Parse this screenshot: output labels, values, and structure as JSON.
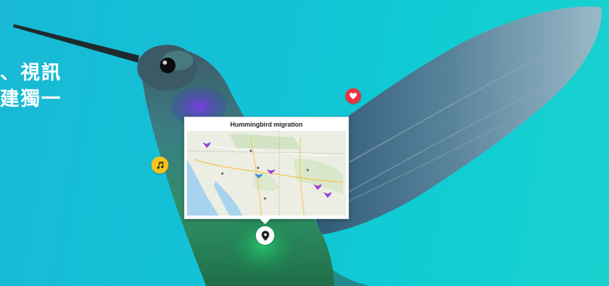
{
  "hero": {
    "text_lines": [
      "、視訊",
      "建獨一"
    ],
    "background_colors": [
      "#19b9d6",
      "#0fcdd3"
    ]
  },
  "pins": {
    "heart": {
      "icon": "heart-icon",
      "color": "#e8343f"
    },
    "music": {
      "icon": "music-note-icon",
      "color": "#f4c31a"
    },
    "location": {
      "icon": "map-marker-icon",
      "color": "#ffffff"
    }
  },
  "map_card": {
    "title": "Hummingbird migration",
    "bird_marker_colors": [
      "#9b3fd6",
      "#2f8fd8"
    ]
  }
}
